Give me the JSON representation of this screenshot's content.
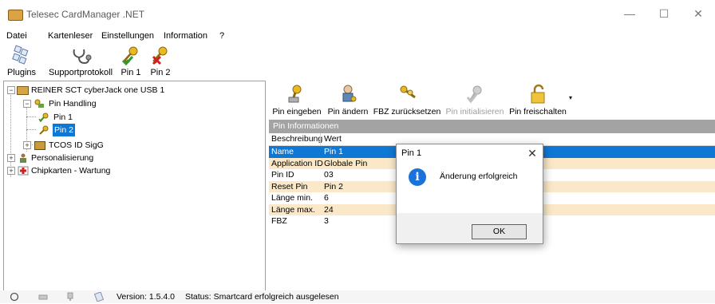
{
  "window": {
    "title": "Telesec CardManager .NET",
    "minimize_glyph": "—",
    "maximize_glyph": "☐",
    "close_glyph": "✕"
  },
  "menu": [
    "Datei",
    "Kartenleser",
    "Einstellungen",
    "Information",
    "?"
  ],
  "toolbar": [
    {
      "label": "Plugins",
      "icon": "plugins-icon"
    },
    {
      "label": "Supportprotokoll",
      "icon": "stethoscope-icon"
    },
    {
      "label": "Pin 1",
      "icon": "key-check-icon"
    },
    {
      "label": "Pin 2",
      "icon": "key-x-icon"
    }
  ],
  "tree": {
    "reader": "REINER SCT cyberJack one USB 1",
    "pin_handling": "Pin Handling",
    "pin1": "Pin 1",
    "pin2": "Pin 2",
    "tcos": "TCOS ID SigG",
    "personalisierung": "Personalisierung",
    "chipkarten": "Chipkarten - Wartung"
  },
  "pin_actions": [
    {
      "label": "Pin eingeben",
      "icon": "key-enter-icon",
      "enabled": true
    },
    {
      "label": "Pin ändern",
      "icon": "person-key-icon",
      "enabled": true
    },
    {
      "label": "FBZ zurücksetzen",
      "icon": "keys-reset-icon",
      "enabled": true
    },
    {
      "label": "Pin initialisieren",
      "icon": "key-init-icon",
      "enabled": false
    },
    {
      "label": "Pin freischalten",
      "icon": "unlock-icon",
      "enabled": true
    }
  ],
  "pin_info": {
    "header": "Pin Informationen",
    "columns": [
      "Beschreibung",
      "Wert"
    ],
    "rows": [
      [
        "Name",
        "Pin 1"
      ],
      [
        "Application ID",
        "Globale Pin"
      ],
      [
        "Pin ID",
        "03"
      ],
      [
        "Reset Pin",
        "Pin 2"
      ],
      [
        "Länge min.",
        "6"
      ],
      [
        "Länge max.",
        "24"
      ],
      [
        "FBZ",
        "3"
      ]
    ]
  },
  "dialog": {
    "title": "Pin 1",
    "close_glyph": "✕",
    "icon_glyph": "i",
    "message": "Änderung erfolgreich",
    "ok": "OK"
  },
  "status": {
    "version": "Version: 1.5.4.0",
    "status": "Status: Smartcard erfolgreich ausgelesen"
  },
  "colors": {
    "selection": "#0f78d4",
    "alt_row": "#fbe8c8",
    "header_gray": "#a3a3a3",
    "info_blue": "#1a73d9"
  }
}
